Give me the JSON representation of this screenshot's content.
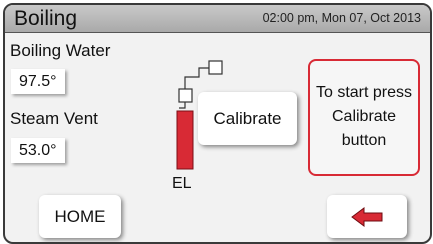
{
  "header": {
    "title": "Boiling",
    "datetime": "02:00 pm, Mon 07, Oct 2013"
  },
  "boiling_water": {
    "label": "Boiling Water",
    "value": "97.5°"
  },
  "steam_vent": {
    "label": "Steam Vent",
    "value": "53.0°"
  },
  "diagram": {
    "element_label": "EL"
  },
  "calibrate_button": {
    "label": "Calibrate"
  },
  "instruction": {
    "line1": "To start press",
    "line2": "Calibrate",
    "line3": "button"
  },
  "home_button": {
    "label": "HOME"
  },
  "colors": {
    "accent_red": "#d82a35",
    "element_fill": "#d82a35",
    "header_bg": "#b4b4b4"
  },
  "icons": {
    "back": "left-arrow-icon"
  }
}
